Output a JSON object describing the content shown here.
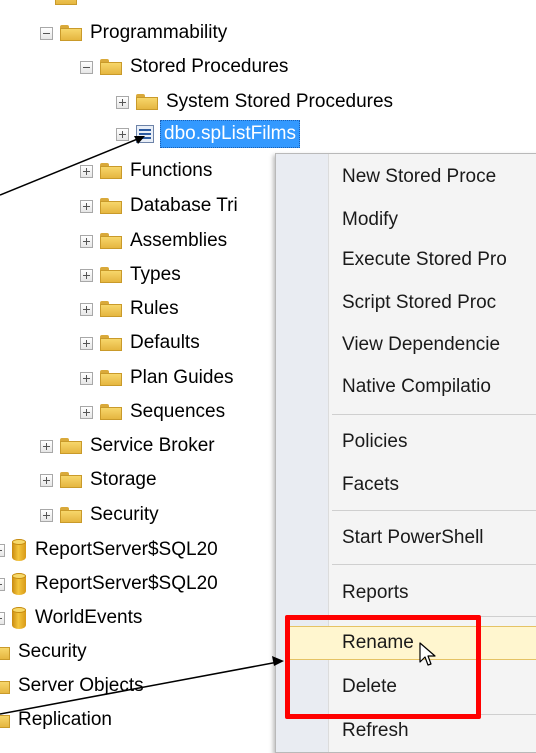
{
  "tree": {
    "programmability": "Programmability",
    "stored_procedures": "Stored Procedures",
    "system_stored_procedures": "System Stored Procedures",
    "selected_item": "dbo.spListFilms",
    "functions": "Functions",
    "database_triggers": "Database Tri",
    "assemblies": "Assemblies",
    "types": "Types",
    "rules": "Rules",
    "defaults": "Defaults",
    "plan_guides": "Plan Guides",
    "sequences": "Sequences",
    "service_broker": "Service Broker",
    "storage": "Storage",
    "security_inner": "Security",
    "reportserver_1": "ReportServer$SQL20",
    "reportserver_2": "ReportServer$SQL20",
    "worldevents": "WorldEvents",
    "security_outer": "Security",
    "server_objects": "Server Objects",
    "replication": "Replication"
  },
  "context_menu": {
    "new_stored_procedure": "New Stored Proce",
    "modify": "Modify",
    "execute_stored_procedure": "Execute Stored Pro",
    "script_stored_procedure": "Script Stored Proc",
    "view_dependencies": "View Dependencie",
    "native_compilation": "Native Compilatio",
    "policies": "Policies",
    "facets": "Facets",
    "start_powershell": "Start PowerShell",
    "reports": "Reports",
    "rename": "Rename",
    "delete": "Delete",
    "refresh": "Refresh"
  },
  "colors": {
    "selection": "#3399ff",
    "highlight_box": "#ff0000",
    "menu_hover": "#fff6cf"
  }
}
